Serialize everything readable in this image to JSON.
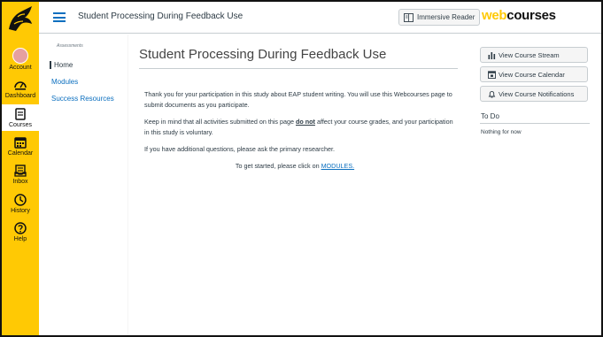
{
  "header": {
    "breadcrumb": "Student Processing During Feedback Use",
    "immersive_reader_label": "Immersive Reader",
    "brand_web": "web",
    "brand_courses": "courses"
  },
  "global_nav": {
    "items": [
      {
        "label": "Account",
        "icon": "account-avatar-icon"
      },
      {
        "label": "Dashboard",
        "icon": "dashboard-icon"
      },
      {
        "label": "Courses",
        "icon": "courses-icon",
        "active": true
      },
      {
        "label": "Calendar",
        "icon": "calendar-icon"
      },
      {
        "label": "Inbox",
        "icon": "inbox-icon"
      },
      {
        "label": "History",
        "icon": "history-icon"
      },
      {
        "label": "Help",
        "icon": "help-icon"
      }
    ]
  },
  "course_nav": {
    "subtitle": "Assessments",
    "items": [
      {
        "label": "Home",
        "active": true
      },
      {
        "label": "Modules"
      },
      {
        "label": "Success Resources"
      }
    ]
  },
  "main": {
    "title": "Student Processing During Feedback Use",
    "para1": "Thank you for your participation in this study about EAP student writing. You will use this Webcourses page to submit documents as you participate.",
    "para2_before": "Keep in mind that all activities submitted on this page ",
    "para2_emph": "do not",
    "para2_after": " affect your course grades, and your participation in this study is voluntary.",
    "para3": "If you have additional questions, please ask the primary researcher.",
    "start_text": "To get started, please click on ",
    "start_link": "MODULES."
  },
  "right_side": {
    "buttons": [
      {
        "label": "View Course Stream",
        "icon": "bar-chart-icon"
      },
      {
        "label": "View Course Calendar",
        "icon": "calendar-icon"
      },
      {
        "label": "View Course Notifications",
        "icon": "bell-icon"
      }
    ],
    "todo_heading": "To Do",
    "todo_empty": "Nothing for now"
  },
  "colors": {
    "brand_gold": "#ffc904",
    "link_blue": "#0b6fbf",
    "text": "#2d3b45"
  }
}
